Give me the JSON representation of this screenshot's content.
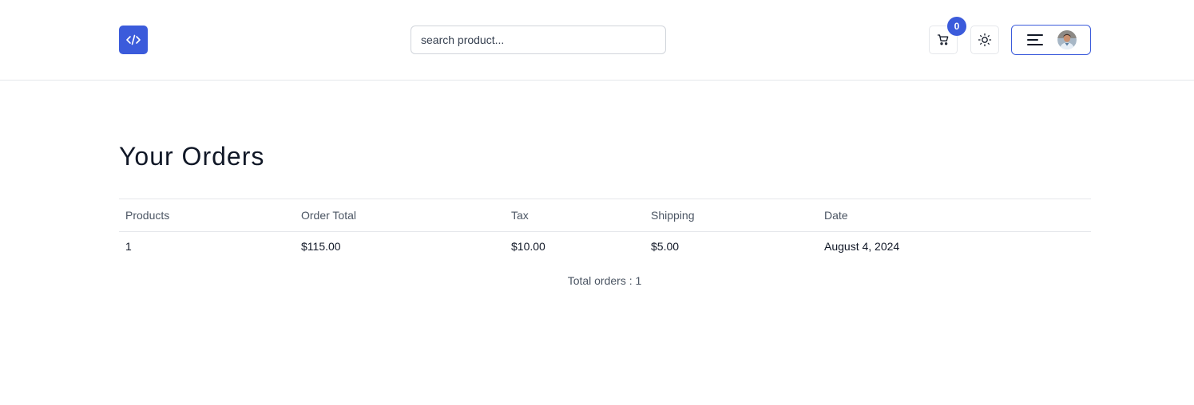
{
  "header": {
    "logo_icon": "code-brackets-icon",
    "search": {
      "placeholder": "search product...",
      "value": ""
    },
    "cart": {
      "icon": "cart-icon",
      "count": "0"
    },
    "theme_toggle": {
      "icon": "sun-icon"
    },
    "user_menu": {
      "icon": "hamburger-icon",
      "avatar": "avatar"
    }
  },
  "main": {
    "title": "Your Orders",
    "table": {
      "columns": [
        "Products",
        "Order Total",
        "Tax",
        "Shipping",
        "Date"
      ],
      "rows": [
        [
          "1",
          "$115.00",
          "$10.00",
          "$5.00",
          "August 4, 2024"
        ]
      ]
    },
    "total_orders": "Total orders : 1"
  },
  "colors": {
    "accent": "#3b5bdb",
    "border": "#e5e7eb",
    "muted_text": "#4b5563"
  }
}
